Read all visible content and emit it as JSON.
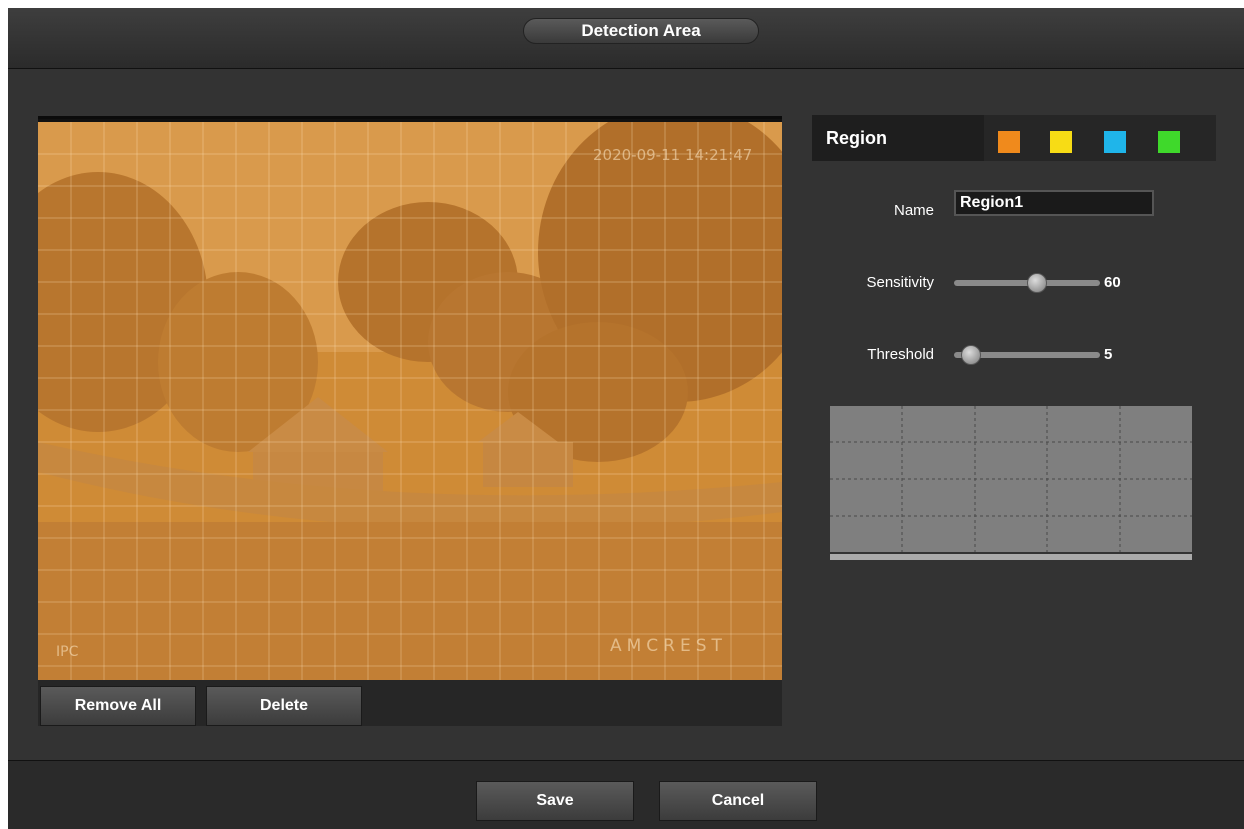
{
  "dialog": {
    "title": "Detection Area"
  },
  "video": {
    "timestamp": "2020-09-11 14:21:47",
    "channel_label": "IPC",
    "brand": "AMCREST"
  },
  "video_buttons": {
    "remove_all": "Remove All",
    "delete": "Delete"
  },
  "region": {
    "label": "Region",
    "swatches": [
      "#f08a1c",
      "#f7dc15",
      "#1fb5ea",
      "#3fd92b"
    ],
    "selected_index": 0
  },
  "name_field": {
    "label": "Name",
    "value": "Region1"
  },
  "sensitivity": {
    "label": "Sensitivity",
    "value": "60"
  },
  "threshold": {
    "label": "Threshold",
    "value": "5"
  },
  "footer": {
    "save": "Save",
    "cancel": "Cancel"
  }
}
